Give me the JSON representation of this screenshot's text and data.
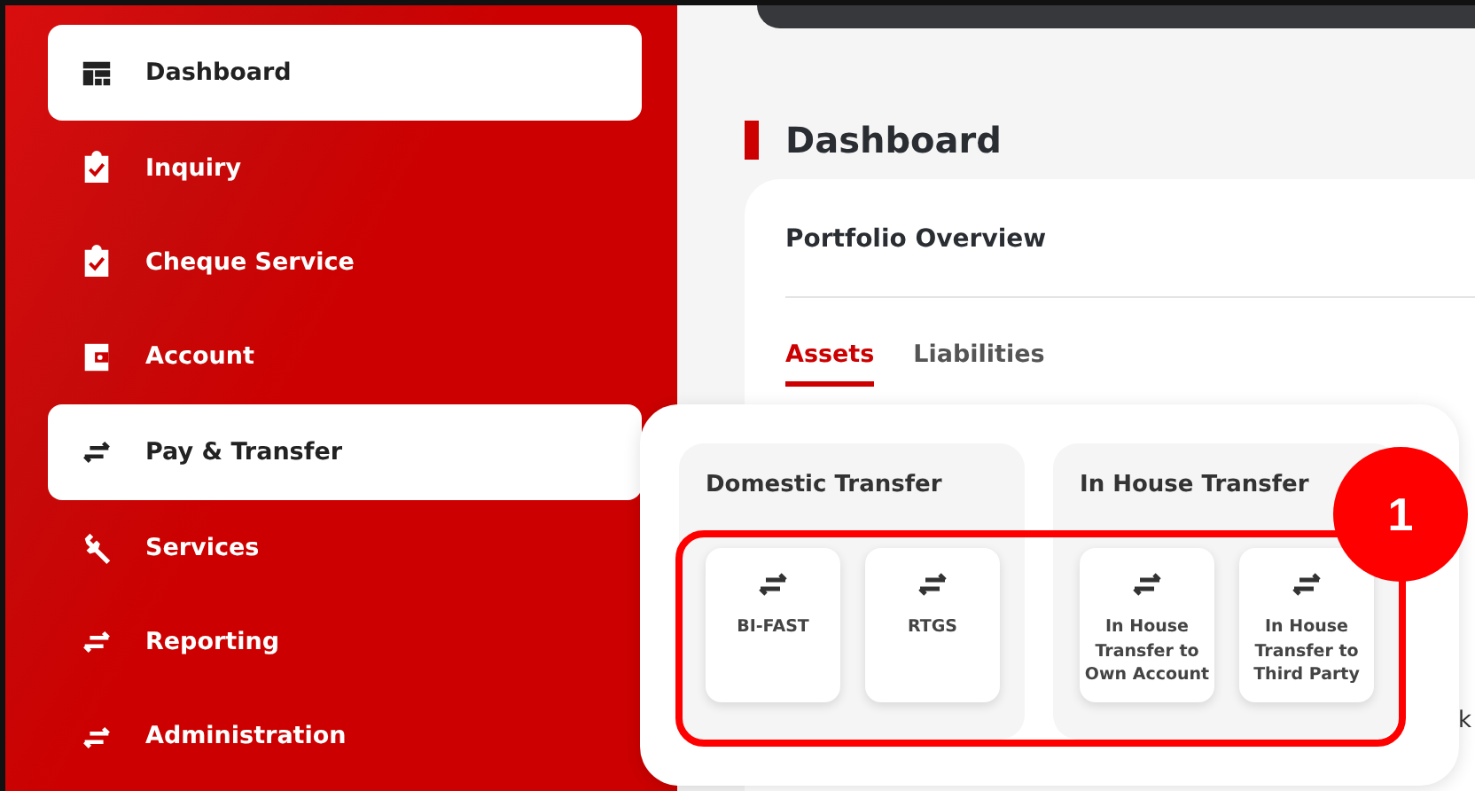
{
  "sidebar": {
    "items": [
      {
        "label": "Dashboard",
        "kind": "dashboard",
        "selected": true
      },
      {
        "label": "Inquiry",
        "kind": "clipboard",
        "selected": false
      },
      {
        "label": "Cheque Service",
        "kind": "clipboard",
        "selected": false
      },
      {
        "label": "Account",
        "kind": "wallet",
        "selected": false
      },
      {
        "label": "Pay & Transfer",
        "kind": "swap",
        "selected": true
      },
      {
        "label": "Services",
        "kind": "wrench",
        "selected": false
      },
      {
        "label": "Reporting",
        "kind": "swap",
        "selected": false
      },
      {
        "label": "Administration",
        "kind": "swap",
        "selected": false
      }
    ]
  },
  "page_title": "Dashboard",
  "card": {
    "title": "Portfolio Overview",
    "tabs": [
      {
        "label": "Assets",
        "selected": true
      },
      {
        "label": "Liabilities",
        "selected": false
      }
    ],
    "partial_text": "k"
  },
  "menu": {
    "groups": [
      {
        "title": "Domestic Transfer",
        "items": [
          "BI-FAST",
          "RTGS"
        ]
      },
      {
        "title": "In House Transfer",
        "items": [
          "In House Transfer to Own Account",
          "In House Transfer to Third Party"
        ]
      }
    ]
  },
  "callout": {
    "number": "1"
  }
}
